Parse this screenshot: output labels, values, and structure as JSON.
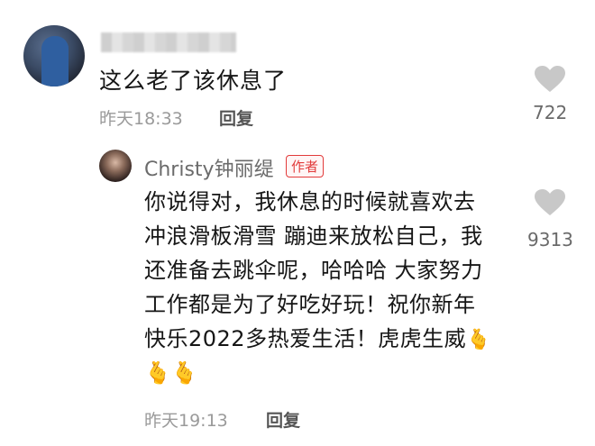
{
  "comment1": {
    "username": "",
    "text": "这么老了该休息了",
    "time": "昨天18:33",
    "reply_label": "回复",
    "likes": "722"
  },
  "comment2": {
    "author": "Christy钟丽缇",
    "author_badge": "作者",
    "lines": [
      "你说得对，我休息的时候就喜欢去",
      "冲浪滑板滑雪 蹦迪来放松自己，我",
      "还准备去跳伞呢，哈哈哈 大家努力",
      "工作都是为了好吃好玩！祝你新年",
      "快乐2022多热爱生活！虎虎生威"
    ],
    "emoji_inline": "🫰",
    "emoji_row": "🫰🫰",
    "time": "昨天19:13",
    "reply_label": "回复",
    "likes": "9313"
  },
  "colors": {
    "text": "#161616",
    "meta": "#9a9a9a",
    "heart": "#c8c8c8",
    "badge": "#e23b3b"
  },
  "icons": [
    "heart-icon",
    "finger-heart-emoji"
  ]
}
